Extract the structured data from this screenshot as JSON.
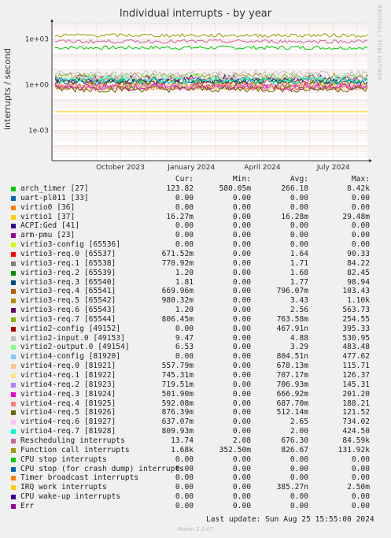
{
  "title": "Individual interrupts - by year",
  "vertical_label": "interrupts / second",
  "side_text": "RRDTOOL / TOBI OETIKER",
  "footer": "Munin 2.0.67",
  "last_update": "Last update: Sun Aug 25 15:55:00 2024",
  "legend_headers": [
    "Cur:",
    "Min:",
    "Avg:",
    "Max:"
  ],
  "chart_data": {
    "type": "line",
    "y_scale": "log",
    "y_ticks": [
      "1e+03",
      "1e+00",
      "1e-03"
    ],
    "x_ticks": [
      "October 2023",
      "January 2024",
      "April 2024",
      "July 2024"
    ],
    "grid": true,
    "series": [
      {
        "name": "arch_timer [27]",
        "color": "#00cc00",
        "cur": "123.82",
        "min": "580.05m",
        "avg": "266.18",
        "max": "8.42k",
        "level": 266
      },
      {
        "name": "uart-pl011 [33]",
        "color": "#0066b3",
        "cur": "0.00",
        "min": "0.00",
        "avg": "0.00",
        "max": "0.00",
        "level": 0
      },
      {
        "name": "virtio0 [36]",
        "color": "#ff8000",
        "cur": "0.00",
        "min": "0.00",
        "avg": "0.00",
        "max": "0.00",
        "level": 0
      },
      {
        "name": "virtio1 [37]",
        "color": "#ffcc00",
        "cur": "16.27m",
        "min": "0.00",
        "avg": "16.28m",
        "max": "29.48m",
        "level": 0.0163
      },
      {
        "name": "ACPI:Ged [41]",
        "color": "#330099",
        "cur": "0.00",
        "min": "0.00",
        "avg": "0.00",
        "max": "0.00",
        "level": 0
      },
      {
        "name": "arm-pmu [23]",
        "color": "#990099",
        "cur": "0.00",
        "min": "0.00",
        "avg": "0.00",
        "max": "0.00",
        "level": 0
      },
      {
        "name": "virtio3-config [65536]",
        "color": "#ccff00",
        "cur": "0.00",
        "min": "0.00",
        "avg": "0.00",
        "max": "0.00",
        "level": 0
      },
      {
        "name": "virtio3-req.0 [65537]",
        "color": "#ff0000",
        "cur": "671.52m",
        "min": "0.00",
        "avg": "1.64",
        "max": "90.33",
        "level": 1.64
      },
      {
        "name": "virtio3-req.1 [65538]",
        "color": "#808080",
        "cur": "770.92m",
        "min": "0.00",
        "avg": "1.71",
        "max": "84.22",
        "level": 1.71
      },
      {
        "name": "virtio3-req.2 [65539]",
        "color": "#008f00",
        "cur": "1.20",
        "min": "0.00",
        "avg": "1.68",
        "max": "82.45",
        "level": 1.68
      },
      {
        "name": "virtio3-req.3 [65540]",
        "color": "#00487d",
        "cur": "1.81",
        "min": "0.00",
        "avg": "1.77",
        "max": "98.94",
        "level": 1.77
      },
      {
        "name": "virtio3-req.4 [65541]",
        "color": "#b35a00",
        "cur": "669.96m",
        "min": "0.00",
        "avg": "796.07m",
        "max": "103.43",
        "level": 0.8
      },
      {
        "name": "virtio3-req.5 [65542]",
        "color": "#b38f00",
        "cur": "980.32m",
        "min": "0.00",
        "avg": "3.43",
        "max": "1.10k",
        "level": 3.43
      },
      {
        "name": "virtio3-req.6 [65543]",
        "color": "#6b006b",
        "cur": "1.20",
        "min": "0.00",
        "avg": "2.56",
        "max": "563.73",
        "level": 2.56
      },
      {
        "name": "virtio3-req.7 [65544]",
        "color": "#8fb300",
        "cur": "806.45m",
        "min": "0.00",
        "avg": "763.58m",
        "max": "254.55",
        "level": 0.76
      },
      {
        "name": "virtio2-config [49152]",
        "color": "#b30000",
        "cur": "0.00",
        "min": "0.00",
        "avg": "467.91n",
        "max": "395.33",
        "level": 0
      },
      {
        "name": "virtio2-input.0 [49153]",
        "color": "#bebebe",
        "cur": "9.47",
        "min": "0.00",
        "avg": "4.88",
        "max": "530.95",
        "level": 4.88
      },
      {
        "name": "virtio2-output.0 [49154]",
        "color": "#80ff80",
        "cur": "6.53",
        "min": "0.00",
        "avg": "3.29",
        "max": "483.48",
        "level": 3.29
      },
      {
        "name": "virtio4-config [81920]",
        "color": "#80c9ff",
        "cur": "0.00",
        "min": "0.00",
        "avg": "804.51n",
        "max": "477.62",
        "level": 0
      },
      {
        "name": "virtio4-req.0 [81921]",
        "color": "#ffc080",
        "cur": "557.79m",
        "min": "0.00",
        "avg": "678.13m",
        "max": "115.71",
        "level": 0.68
      },
      {
        "name": "virtio4-req.1 [81922]",
        "color": "#ffe680",
        "cur": "745.31m",
        "min": "0.00",
        "avg": "707.17m",
        "max": "126.37",
        "level": 0.71
      },
      {
        "name": "virtio4-req.2 [81923]",
        "color": "#aa80ff",
        "cur": "719.51m",
        "min": "0.00",
        "avg": "706.93m",
        "max": "145.31",
        "level": 0.71
      },
      {
        "name": "virtio4-req.3 [81924]",
        "color": "#ee00cc",
        "cur": "501.90m",
        "min": "0.00",
        "avg": "666.92m",
        "max": "201.20",
        "level": 0.67
      },
      {
        "name": "virtio4-req.4 [81925]",
        "color": "#ff8080",
        "cur": "592.08m",
        "min": "0.00",
        "avg": "687.70m",
        "max": "188.21",
        "level": 0.69
      },
      {
        "name": "virtio4-req.5 [81926]",
        "color": "#666600",
        "cur": "876.39m",
        "min": "0.00",
        "avg": "512.14m",
        "max": "121.52",
        "level": 0.51
      },
      {
        "name": "virtio4-req.6 [81927]",
        "color": "#ffbfff",
        "cur": "637.07m",
        "min": "0.00",
        "avg": "2.65",
        "max": "734.02",
        "level": 2.65
      },
      {
        "name": "virtio4-req.7 [81928]",
        "color": "#00ffcc",
        "cur": "809.93m",
        "min": "0.00",
        "avg": "2.00",
        "max": "424.50",
        "level": 2.0
      },
      {
        "name": "Rescheduling interrupts",
        "color": "#cc6699",
        "cur": "13.74",
        "min": "2.08",
        "avg": "676.30",
        "max": "84.59k",
        "level": 676
      },
      {
        "name": "Function call interrupts",
        "color": "#999900",
        "cur": "1.68k",
        "min": "352.50m",
        "avg": "826.67",
        "max": "131.92k",
        "level": 1680
      },
      {
        "name": "CPU stop interrupts",
        "color": "#00cc00",
        "cur": "0.00",
        "min": "0.00",
        "avg": "0.00",
        "max": "0.00",
        "level": 0
      },
      {
        "name": "CPU stop (for crash dump) interrupts",
        "color": "#0066b3",
        "cur": "0.00",
        "min": "0.00",
        "avg": "0.00",
        "max": "0.00",
        "level": 0
      },
      {
        "name": "Timer broadcast interrupts",
        "color": "#ff8000",
        "cur": "0.00",
        "min": "0.00",
        "avg": "0.00",
        "max": "0.00",
        "level": 0
      },
      {
        "name": "IRQ work interrupts",
        "color": "#ffcc00",
        "cur": "0.00",
        "min": "0.00",
        "avg": "385.27n",
        "max": "2.50m",
        "level": 0
      },
      {
        "name": "CPU wake-up interrupts",
        "color": "#330099",
        "cur": "0.00",
        "min": "0.00",
        "avg": "0.00",
        "max": "0.00",
        "level": 0
      },
      {
        "name": "Err",
        "color": "#990099",
        "cur": "0.00",
        "min": "0.00",
        "avg": "0.00",
        "max": "0.00",
        "level": 0
      }
    ]
  }
}
